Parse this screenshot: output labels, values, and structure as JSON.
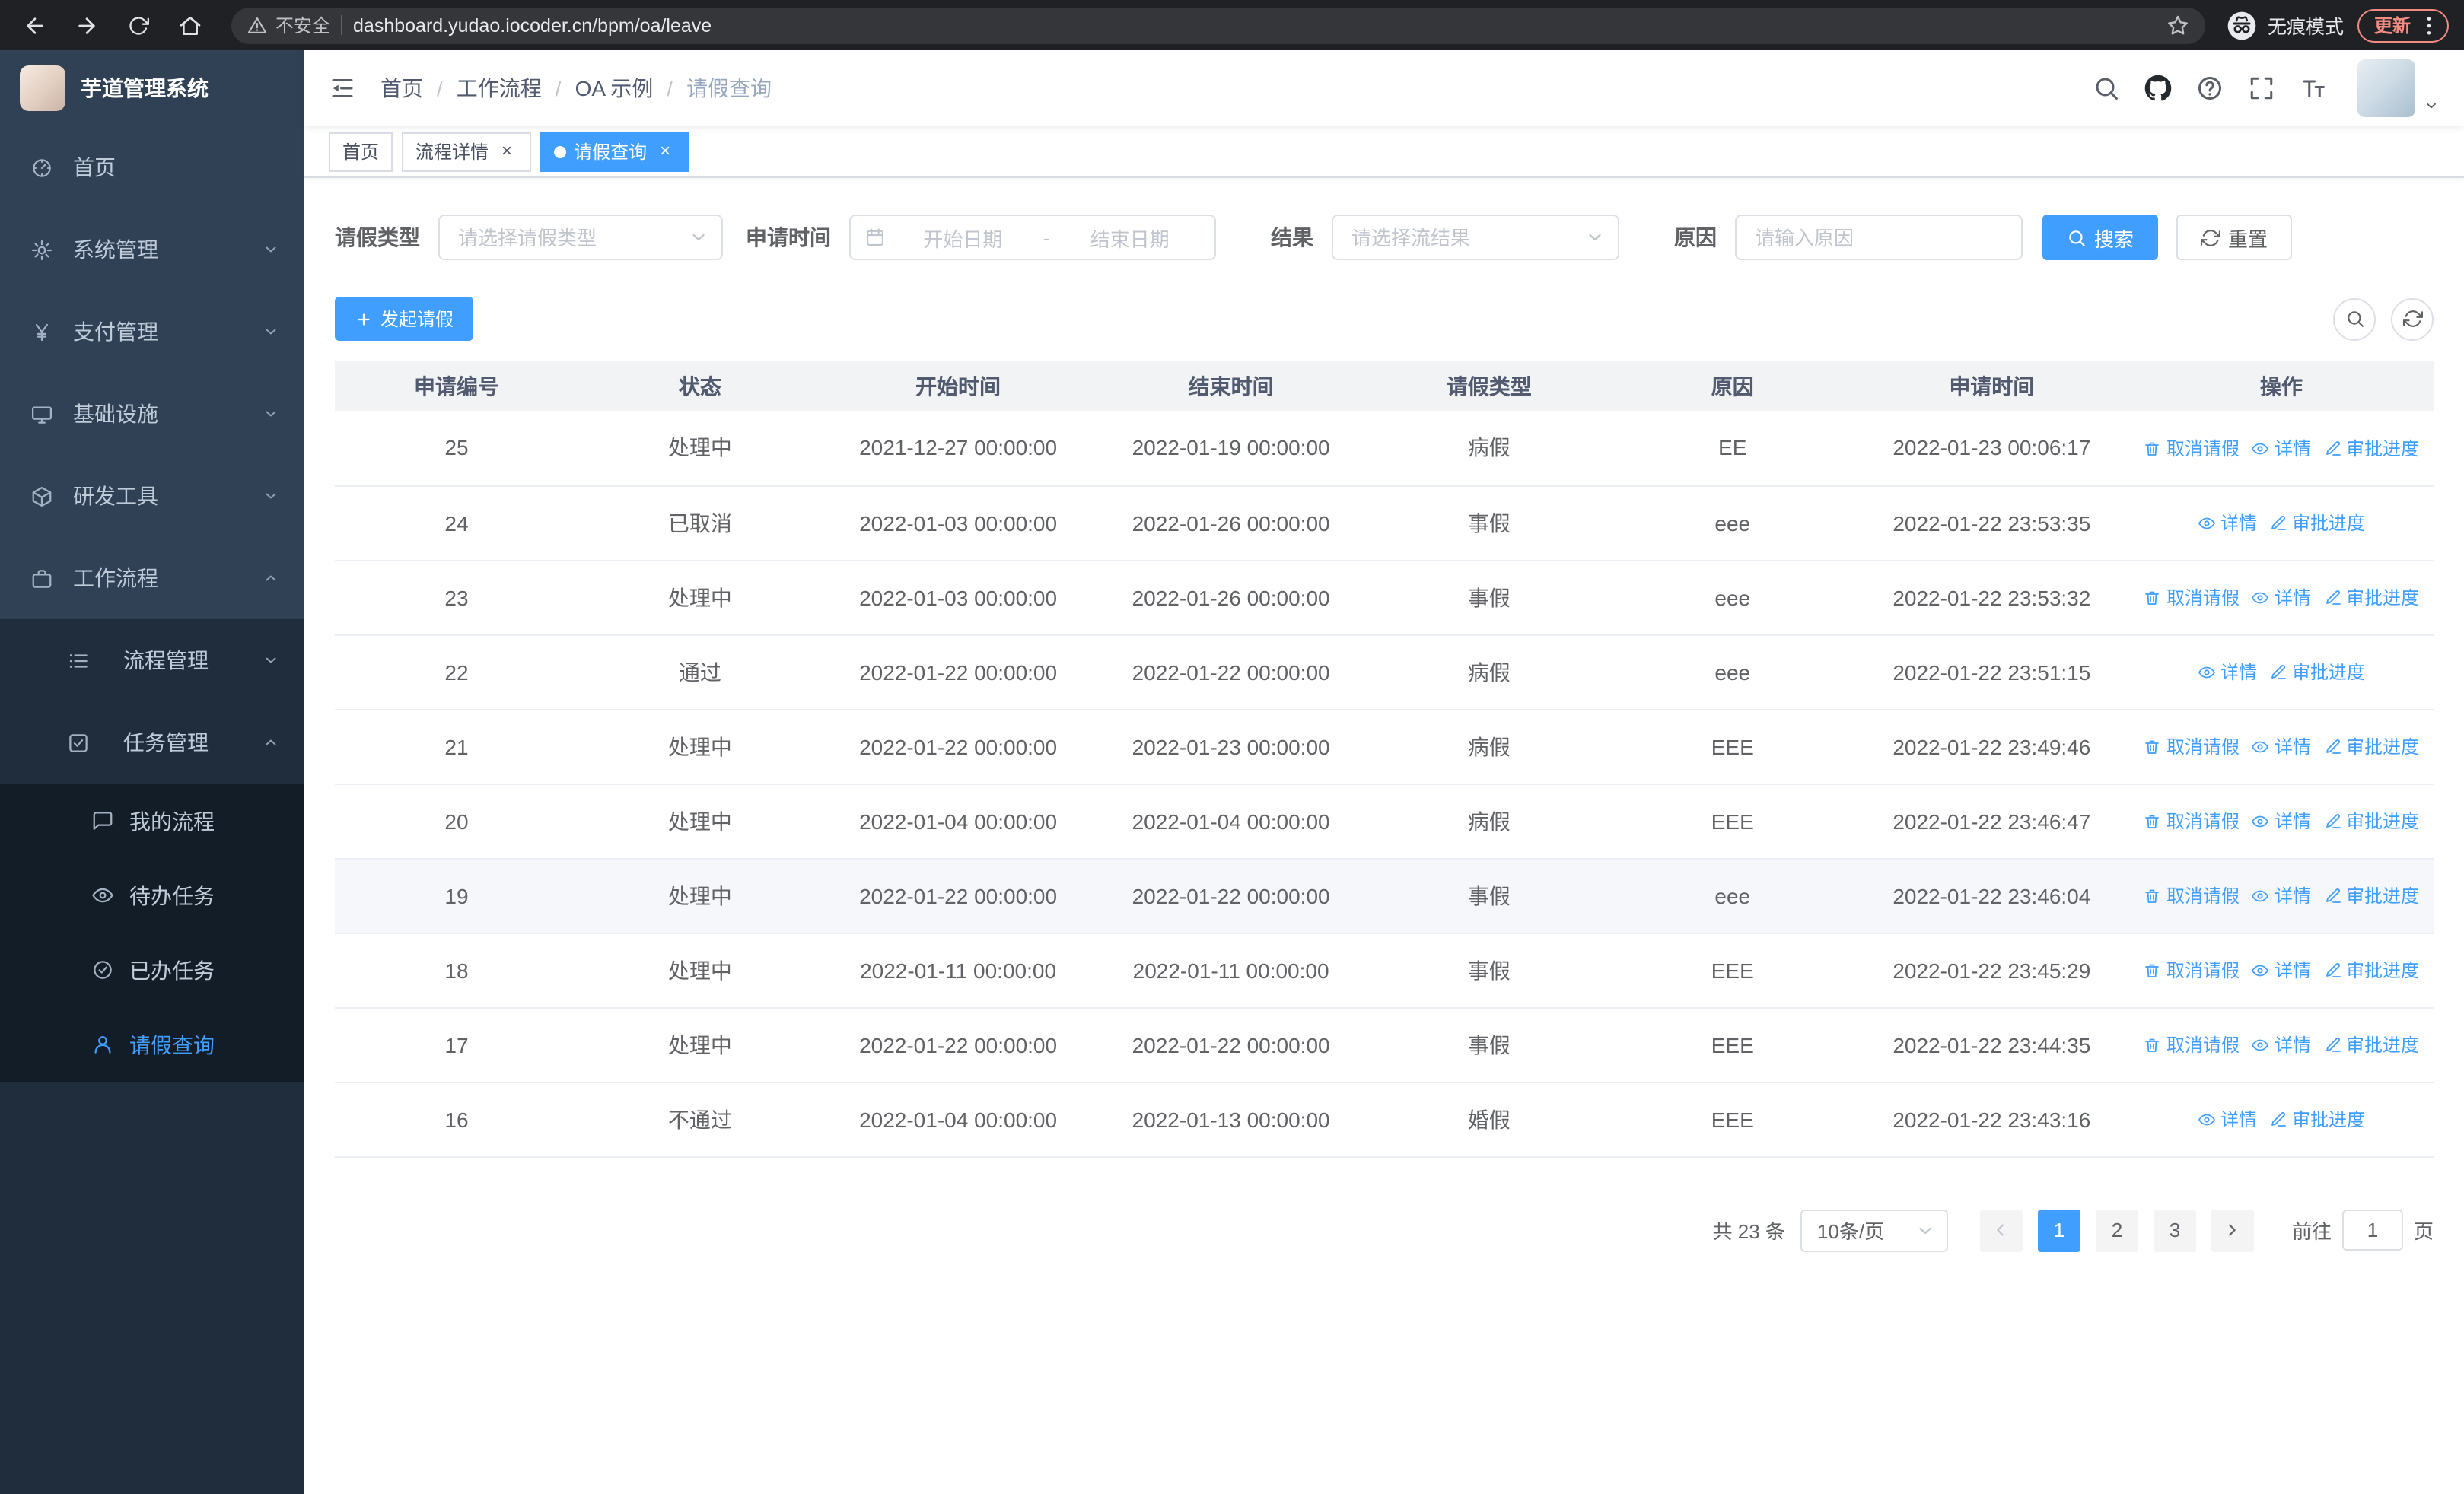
{
  "browser": {
    "security_warning": "不安全",
    "url": "dashboard.yudao.iocoder.cn/bpm/oa/leave",
    "incognito_label": "无痕模式",
    "update_label": "更新"
  },
  "colors": {
    "accent": "#409EFF",
    "sidebar_bg": "#304156",
    "sidebar_submenu_bg": "#1f2d3d",
    "table_header_bg": "#f2f3f5"
  },
  "sidebar": {
    "logo_title": "芋道管理系统",
    "items": [
      {
        "label": "首页"
      },
      {
        "label": "系统管理"
      },
      {
        "label": "支付管理"
      },
      {
        "label": "基础设施"
      },
      {
        "label": "研发工具"
      },
      {
        "label": "工作流程"
      },
      {
        "label": "流程管理"
      },
      {
        "label": "任务管理"
      },
      {
        "label": "我的流程"
      },
      {
        "label": "待办任务"
      },
      {
        "label": "已办任务"
      },
      {
        "label": "请假查询"
      }
    ]
  },
  "header": {
    "breadcrumb": [
      "首页",
      "工作流程",
      "OA 示例",
      "请假查询"
    ]
  },
  "tabs": [
    {
      "label": "首页"
    },
    {
      "label": "流程详情"
    },
    {
      "label": "请假查询"
    }
  ],
  "filters": {
    "leave_type_label": "请假类型",
    "leave_type_placeholder": "请选择请假类型",
    "apply_time_label": "申请时间",
    "start_date_placeholder": "开始日期",
    "range_separator": "-",
    "end_date_placeholder": "结束日期",
    "result_label": "结果",
    "result_placeholder": "请选择流结果",
    "reason_label": "原因",
    "reason_placeholder": "请输入原因",
    "search_button": "搜索",
    "reset_button": "重置"
  },
  "toolbar": {
    "create_button": "发起请假"
  },
  "table": {
    "columns": [
      "申请编号",
      "状态",
      "开始时间",
      "结束时间",
      "请假类型",
      "原因",
      "申请时间",
      "操作"
    ],
    "action_labels": {
      "cancel": "取消请假",
      "detail": "详情",
      "progress": "审批进度"
    },
    "rows": [
      {
        "id": "25",
        "status": "处理中",
        "start": "2021-12-27 00:00:00",
        "end": "2022-01-19 00:00:00",
        "type": "病假",
        "reason": "EE",
        "apply_time": "2022-01-23 00:06:17",
        "actions": [
          "cancel",
          "detail",
          "progress"
        ]
      },
      {
        "id": "24",
        "status": "已取消",
        "start": "2022-01-03 00:00:00",
        "end": "2022-01-26 00:00:00",
        "type": "事假",
        "reason": "eee",
        "apply_time": "2022-01-22 23:53:35",
        "actions": [
          "detail",
          "progress"
        ]
      },
      {
        "id": "23",
        "status": "处理中",
        "start": "2022-01-03 00:00:00",
        "end": "2022-01-26 00:00:00",
        "type": "事假",
        "reason": "eee",
        "apply_time": "2022-01-22 23:53:32",
        "actions": [
          "cancel",
          "detail",
          "progress"
        ]
      },
      {
        "id": "22",
        "status": "通过",
        "start": "2022-01-22 00:00:00",
        "end": "2022-01-22 00:00:00",
        "type": "病假",
        "reason": "eee",
        "apply_time": "2022-01-22 23:51:15",
        "actions": [
          "detail",
          "progress"
        ]
      },
      {
        "id": "21",
        "status": "处理中",
        "start": "2022-01-22 00:00:00",
        "end": "2022-01-23 00:00:00",
        "type": "病假",
        "reason": "EEE",
        "apply_time": "2022-01-22 23:49:46",
        "actions": [
          "cancel",
          "detail",
          "progress"
        ]
      },
      {
        "id": "20",
        "status": "处理中",
        "start": "2022-01-04 00:00:00",
        "end": "2022-01-04 00:00:00",
        "type": "病假",
        "reason": "EEE",
        "apply_time": "2022-01-22 23:46:47",
        "actions": [
          "cancel",
          "detail",
          "progress"
        ]
      },
      {
        "id": "19",
        "status": "处理中",
        "start": "2022-01-22 00:00:00",
        "end": "2022-01-22 00:00:00",
        "type": "事假",
        "reason": "eee",
        "apply_time": "2022-01-22 23:46:04",
        "actions": [
          "cancel",
          "detail",
          "progress"
        ],
        "highlighted": true
      },
      {
        "id": "18",
        "status": "处理中",
        "start": "2022-01-11 00:00:00",
        "end": "2022-01-11 00:00:00",
        "type": "事假",
        "reason": "EEE",
        "apply_time": "2022-01-22 23:45:29",
        "actions": [
          "cancel",
          "detail",
          "progress"
        ]
      },
      {
        "id": "17",
        "status": "处理中",
        "start": "2022-01-22 00:00:00",
        "end": "2022-01-22 00:00:00",
        "type": "事假",
        "reason": "EEE",
        "apply_time": "2022-01-22 23:44:35",
        "actions": [
          "cancel",
          "detail",
          "progress"
        ]
      },
      {
        "id": "16",
        "status": "不通过",
        "start": "2022-01-04 00:00:00",
        "end": "2022-01-13 00:00:00",
        "type": "婚假",
        "reason": "EEE",
        "apply_time": "2022-01-22 23:43:16",
        "actions": [
          "detail",
          "progress"
        ]
      }
    ]
  },
  "pagination": {
    "total_text": "共 23 条",
    "page_size": "10条/页",
    "pages": [
      "1",
      "2",
      "3"
    ],
    "active_page": "1",
    "goto_label": "前往",
    "goto_value": "1",
    "goto_unit": "页"
  }
}
